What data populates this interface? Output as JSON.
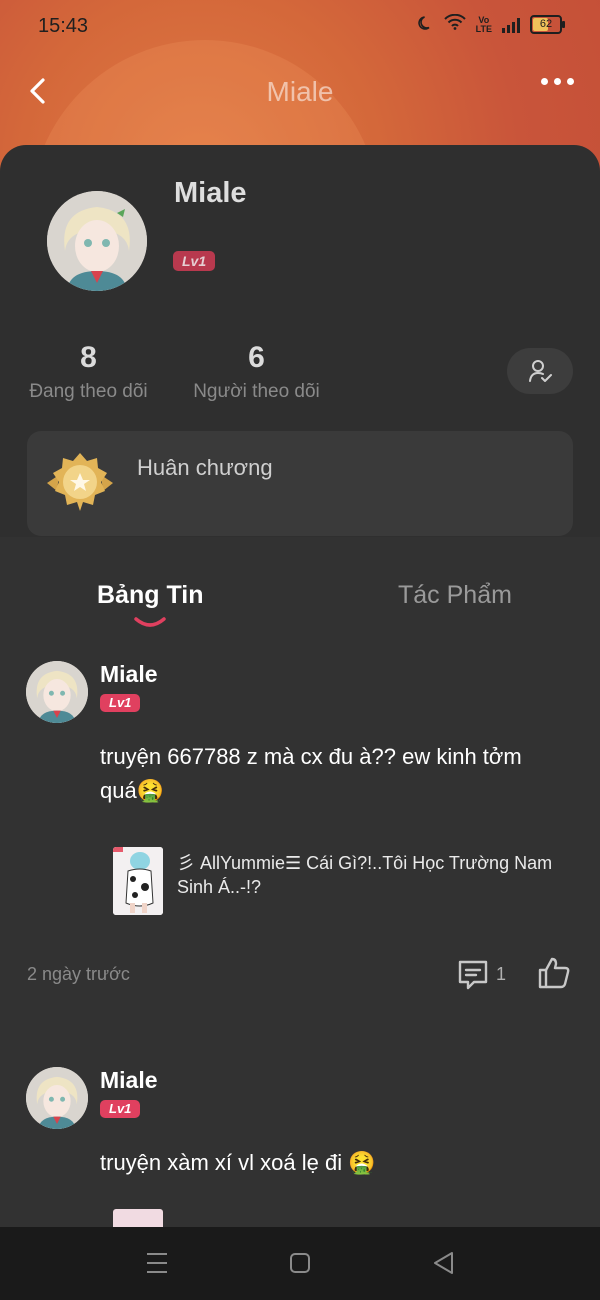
{
  "status_bar": {
    "time": "15:43",
    "volte_top": "Vo",
    "volte_bottom": "LTE",
    "battery_level": 62,
    "battery_label": "62",
    "icons": [
      "moon-icon",
      "wifi-icon",
      "volte-icon",
      "signal-icon",
      "battery-icon"
    ]
  },
  "header": {
    "title": "Miale",
    "back_icon": "chevron-left-icon",
    "more_icon": "more-horizontal-icon"
  },
  "profile": {
    "name": "Miale",
    "level": "Lv1",
    "following_count": "8",
    "following_label": "Đang theo dõi",
    "followers_count": "6",
    "followers_label": "Người theo dõi",
    "follow_icon": "user-check-icon",
    "medal_label": "Huân chương"
  },
  "tabs": [
    {
      "label": "Bảng Tin",
      "active": true
    },
    {
      "label": "Tác Phẩm",
      "active": false
    }
  ],
  "posts": [
    {
      "author": "Miale",
      "level": "Lv1",
      "text": "truyện 667788 z mà cx đu à?? ew kinh tởm quá🤮",
      "ref_title": "彡 AllYummie☰ Cái Gì?!..Tôi Học Trường Nam Sinh Á..-!?",
      "time": "2 ngày trước",
      "comments": "1"
    },
    {
      "author": "Miale",
      "level": "Lv1",
      "text": "truyện xàm xí vl xoá lẹ đi 🤮"
    }
  ],
  "colors": {
    "accent": "#e0405f",
    "header_gradient": "#d4683a",
    "background": "#2f2f2f"
  }
}
